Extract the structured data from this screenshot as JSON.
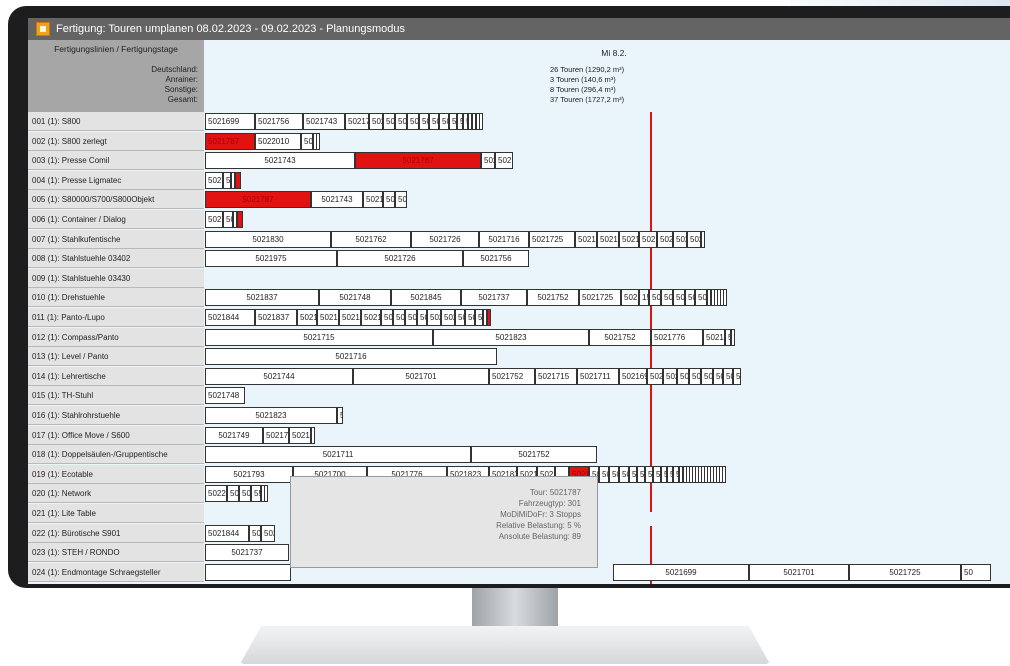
{
  "window": {
    "title": "Fertigung: Touren umplanen 08.02.2023 - 09.02.2023 - Planungsmodus"
  },
  "left_header": {
    "title": "Fertigungslinien / Fertigungstage",
    "labels": [
      "Deutschland:",
      "Anrainer:",
      "Sonstige:",
      "Gesamt:"
    ]
  },
  "day": {
    "label": "Mi 8.2.",
    "stats": [
      "26 Touren (1290,2 m³)",
      "3 Touren (140,6 m³)",
      "8 Touren (296,4 m³)",
      "37 Touren (1727,2 m³)"
    ]
  },
  "rows": [
    "001 (1): S800",
    "002 (1): S800 zerlegt",
    "003 (1): Presse Comil",
    "004 (1): Presse Ligmatec",
    "005 (1): S80000/S700/S800Objekt",
    "006 (1): Container / Dialog",
    "007 (1): Stahlkufentische",
    "008 (1): Stahlstuehle 03402",
    "009 (1): Stahlstuehle 03430",
    "010 (1): Drehstuehle",
    "011 (1): Panto-/Lupo",
    "012 (1): Compass/Panto",
    "013 (1): Level / Panto",
    "014 (1): Lehrertische",
    "015 (1): TH-Stuhl",
    "016 (1): Stahlrohrstuehle",
    "017 (1): Office Move / S600",
    "018 (1): Doppelsäulen-/Gruppentische",
    "019 (1): Ecotable",
    "020 (1): Network",
    "021 (1): Lite Table",
    "022 (1): Bürotische S901",
    "023 (1): STEH / RONDO",
    "024 (1): Endmontage Schraegsteller"
  ],
  "bars": [
    [
      [
        "5021699",
        0,
        50,
        ""
      ],
      [
        "5021756",
        50,
        48,
        ""
      ],
      [
        "5021743",
        98,
        42,
        ""
      ],
      [
        "5021748",
        140,
        24,
        ""
      ],
      [
        "50217",
        164,
        14,
        ""
      ],
      [
        "50217",
        178,
        12,
        ""
      ],
      [
        "50217",
        190,
        12,
        ""
      ],
      [
        "5021",
        202,
        12,
        ""
      ],
      [
        "5021",
        214,
        10,
        ""
      ],
      [
        "5021",
        224,
        10,
        ""
      ],
      [
        "5050",
        234,
        10,
        ""
      ],
      [
        "5050",
        244,
        8,
        ""
      ],
      [
        "50",
        252,
        6,
        ""
      ],
      [
        "50",
        258,
        5,
        ""
      ],
      [
        "5",
        263,
        4,
        ""
      ],
      [
        "5",
        267,
        4,
        ""
      ],
      [
        "",
        271,
        3,
        ""
      ],
      [
        "",
        274,
        3,
        ""
      ]
    ],
    [
      [
        "5021787",
        0,
        50,
        "red"
      ],
      [
        "5022010",
        50,
        46,
        ""
      ],
      [
        "5021",
        96,
        12,
        ""
      ],
      [
        "",
        108,
        3,
        ""
      ],
      [
        "",
        111,
        3,
        ""
      ]
    ],
    [
      [
        "5021743",
        0,
        150,
        "center"
      ],
      [
        "5021787",
        150,
        126,
        "red center"
      ],
      [
        "5021",
        276,
        14,
        ""
      ],
      [
        "502115",
        290,
        18,
        ""
      ]
    ],
    [
      [
        "5021",
        0,
        18,
        ""
      ],
      [
        "50",
        18,
        8,
        ""
      ],
      [
        "5",
        26,
        4,
        ""
      ],
      [
        "",
        30,
        6,
        "red"
      ]
    ],
    [
      [
        "5021787",
        0,
        106,
        "red center"
      ],
      [
        "5021743",
        106,
        52,
        "center"
      ],
      [
        "50217",
        158,
        20,
        ""
      ],
      [
        "5021",
        178,
        12,
        ""
      ],
      [
        "502",
        190,
        12,
        ""
      ]
    ],
    [
      [
        "5021",
        0,
        18,
        ""
      ],
      [
        "50",
        18,
        10,
        ""
      ],
      [
        "5",
        28,
        4,
        ""
      ],
      [
        "",
        32,
        6,
        "red"
      ]
    ],
    [
      [
        "5021830",
        0,
        126,
        "center"
      ],
      [
        "5021762",
        126,
        80,
        "center"
      ],
      [
        "5021726",
        206,
        68,
        "center"
      ],
      [
        "5021716",
        274,
        50,
        "center"
      ],
      [
        "5021725",
        324,
        46,
        ""
      ],
      [
        "50217",
        370,
        22,
        ""
      ],
      [
        "50217",
        392,
        22,
        ""
      ],
      [
        "5021",
        414,
        20,
        ""
      ],
      [
        "5021",
        434,
        18,
        ""
      ],
      [
        "5021",
        452,
        16,
        ""
      ],
      [
        "502",
        468,
        14,
        ""
      ],
      [
        "5025",
        482,
        14,
        ""
      ],
      [
        "",
        496,
        4,
        ""
      ]
    ],
    [
      [
        "5021975",
        0,
        132,
        "center"
      ],
      [
        "5021726",
        132,
        126,
        "center"
      ],
      [
        "5021756",
        258,
        66,
        "center"
      ]
    ],
    [],
    [
      [
        "5021837",
        0,
        114,
        "center"
      ],
      [
        "5021748",
        114,
        72,
        "center"
      ],
      [
        "5021845",
        186,
        70,
        "center"
      ],
      [
        "5021737",
        256,
        66,
        "center"
      ],
      [
        "5021752",
        322,
        52,
        "center"
      ],
      [
        "5021725",
        374,
        42,
        ""
      ],
      [
        "50217",
        416,
        18,
        ""
      ],
      [
        "15",
        434,
        10,
        ""
      ],
      [
        "5021",
        444,
        12,
        ""
      ],
      [
        "502",
        456,
        12,
        ""
      ],
      [
        "502",
        468,
        12,
        ""
      ],
      [
        "502",
        480,
        10,
        ""
      ],
      [
        "5025",
        490,
        12,
        ""
      ],
      [
        "",
        502,
        4,
        ""
      ],
      [
        "",
        506,
        3,
        ""
      ],
      [
        "",
        509,
        3,
        ""
      ],
      [
        "",
        512,
        3,
        ""
      ],
      [
        "",
        515,
        3,
        ""
      ],
      [
        "",
        518,
        3,
        ""
      ]
    ],
    [
      [
        "5021844",
        0,
        50,
        ""
      ],
      [
        "5021837",
        50,
        42,
        ""
      ],
      [
        "50217",
        92,
        20,
        ""
      ],
      [
        "502170",
        112,
        22,
        ""
      ],
      [
        "502170",
        134,
        22,
        ""
      ],
      [
        "50217",
        156,
        20,
        ""
      ],
      [
        "5021",
        176,
        12,
        ""
      ],
      [
        "5021",
        188,
        12,
        ""
      ],
      [
        "502",
        200,
        12,
        ""
      ],
      [
        "502",
        212,
        10,
        ""
      ],
      [
        "50250",
        222,
        14,
        ""
      ],
      [
        "50250",
        236,
        14,
        ""
      ],
      [
        "5050",
        250,
        10,
        ""
      ],
      [
        "5050",
        260,
        10,
        ""
      ],
      [
        "50",
        270,
        8,
        ""
      ],
      [
        "",
        278,
        4,
        ""
      ],
      [
        "",
        282,
        4,
        "red"
      ]
    ],
    [
      [
        "5021715",
        0,
        228,
        "center"
      ],
      [
        "5021823",
        228,
        156,
        "center"
      ],
      [
        "5021752",
        384,
        62,
        "center"
      ],
      [
        "5021776",
        446,
        52,
        ""
      ],
      [
        "50217",
        498,
        22,
        ""
      ],
      [
        "5",
        520,
        6,
        ""
      ],
      [
        "",
        526,
        4,
        ""
      ]
    ],
    [
      [
        "5021716",
        0,
        292,
        "center"
      ]
    ],
    [
      [
        "5021744",
        0,
        148,
        "center"
      ],
      [
        "5021701",
        148,
        136,
        "center"
      ],
      [
        "5021752",
        284,
        46,
        ""
      ],
      [
        "5021715",
        330,
        42,
        ""
      ],
      [
        "5021711",
        372,
        42,
        ""
      ],
      [
        "502169",
        414,
        28,
        ""
      ],
      [
        "50219",
        442,
        16,
        ""
      ],
      [
        "5021",
        458,
        14,
        ""
      ],
      [
        "502",
        472,
        12,
        ""
      ],
      [
        "502",
        484,
        12,
        ""
      ],
      [
        "502",
        496,
        12,
        ""
      ],
      [
        "50",
        508,
        10,
        ""
      ],
      [
        "50",
        518,
        10,
        ""
      ],
      [
        "50",
        528,
        8,
        ""
      ]
    ],
    [
      [
        "5021748",
        0,
        40,
        ""
      ]
    ],
    [
      [
        "5021823",
        0,
        132,
        "center"
      ],
      [
        "5",
        132,
        6,
        ""
      ]
    ],
    [
      [
        "5021749",
        0,
        58,
        "center"
      ],
      [
        "50217",
        58,
        26,
        ""
      ],
      [
        "502183",
        84,
        22,
        ""
      ],
      [
        "5",
        106,
        4,
        ""
      ]
    ],
    [
      [
        "5021711",
        0,
        266,
        "center"
      ],
      [
        "5021752",
        266,
        126,
        "center"
      ]
    ],
    [
      [
        "5021793",
        0,
        88,
        "center"
      ],
      [
        "5021700",
        88,
        74,
        "center"
      ],
      [
        "5021776",
        162,
        80,
        "center"
      ],
      [
        "5021823",
        242,
        42,
        ""
      ],
      [
        "502183",
        284,
        28,
        ""
      ],
      [
        "50217",
        312,
        20,
        ""
      ],
      [
        "50217",
        332,
        18,
        ""
      ],
      [
        "",
        350,
        14,
        ""
      ],
      [
        "5021",
        364,
        20,
        "red"
      ],
      [
        "502",
        384,
        10,
        ""
      ],
      [
        "502",
        394,
        10,
        ""
      ],
      [
        "502",
        404,
        10,
        ""
      ],
      [
        "50",
        414,
        10,
        ""
      ],
      [
        "50",
        424,
        8,
        ""
      ],
      [
        "50",
        432,
        8,
        ""
      ],
      [
        "50",
        440,
        8,
        ""
      ],
      [
        "50",
        448,
        8,
        ""
      ],
      [
        "5",
        456,
        6,
        ""
      ],
      [
        "5",
        462,
        6,
        ""
      ],
      [
        "5",
        468,
        6,
        ""
      ],
      [
        "",
        474,
        4,
        ""
      ],
      [
        "",
        478,
        3,
        ""
      ],
      [
        "",
        481,
        3,
        ""
      ],
      [
        "",
        484,
        3,
        ""
      ],
      [
        "",
        487,
        3,
        ""
      ],
      [
        "",
        490,
        3,
        ""
      ],
      [
        "",
        493,
        3,
        ""
      ],
      [
        "",
        496,
        3,
        ""
      ],
      [
        "",
        499,
        3,
        ""
      ],
      [
        "",
        502,
        3,
        ""
      ],
      [
        "",
        505,
        3,
        ""
      ],
      [
        "",
        508,
        3,
        ""
      ],
      [
        "",
        511,
        3,
        ""
      ],
      [
        "",
        514,
        3,
        ""
      ],
      [
        "",
        517,
        3,
        ""
      ]
    ],
    [
      [
        "502201",
        0,
        22,
        ""
      ],
      [
        "5021",
        22,
        12,
        ""
      ],
      [
        "502",
        34,
        12,
        ""
      ],
      [
        "55",
        46,
        10,
        ""
      ],
      [
        "",
        56,
        3,
        ""
      ],
      [
        "",
        59,
        3,
        ""
      ]
    ],
    [],
    [
      [
        "5021844",
        0,
        44,
        ""
      ],
      [
        "502",
        44,
        12,
        ""
      ],
      [
        "5025",
        56,
        14,
        ""
      ]
    ],
    [
      [
        "5021737",
        0,
        84,
        "center"
      ]
    ],
    [
      [
        "",
        0,
        86,
        ""
      ],
      [
        "5021699",
        408,
        136,
        "center"
      ],
      [
        "5021701",
        544,
        100,
        "center"
      ],
      [
        "5021725",
        644,
        112,
        "center"
      ],
      [
        "50",
        756,
        30,
        ""
      ]
    ]
  ],
  "tooltip": {
    "lines": [
      "Tour: 5021787",
      "Fahrzeugtyp: 301",
      "MoDiMiDoFr: 3 Stopps",
      "Relative Belastung: 5 %",
      "Ansolute Belastung: 89"
    ]
  },
  "colors": {
    "highlight": "#e01212",
    "now_line": "#e01010",
    "titlebar": "#646464",
    "left_panel": "#a6a6a6"
  }
}
